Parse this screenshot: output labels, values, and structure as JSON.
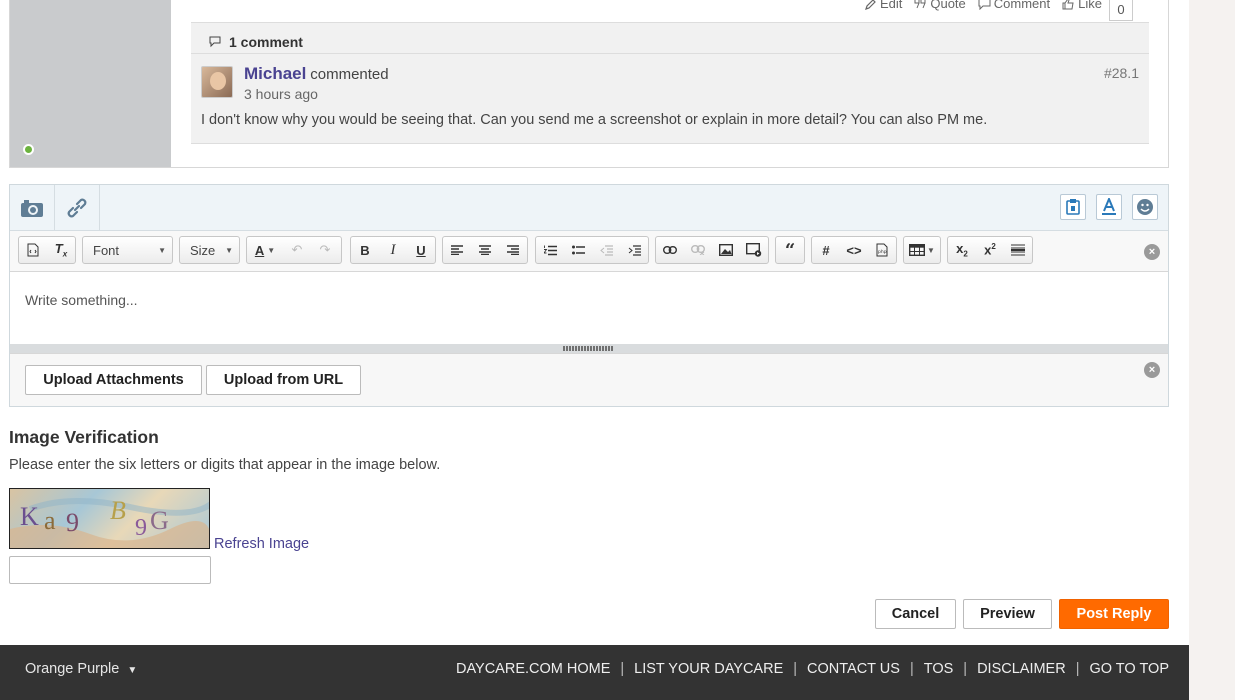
{
  "post": {
    "actions": {
      "edit": "Edit",
      "quote": "Quote",
      "comment": "Comment",
      "like": "Like"
    },
    "like_count": "0",
    "comments_header": "1 comment",
    "comment": {
      "author": "Michael",
      "verb": "commented",
      "time": "3 hours ago",
      "permalink": "#28.1",
      "text": "I don't know why you would be seeing that. Can you send me a screenshot or explain in more detail? You can also PM me."
    }
  },
  "editor": {
    "font_label": "Font",
    "size_label": "Size",
    "placeholder": "Write something...",
    "upload_attachments": "Upload Attachments",
    "upload_from_url": "Upload from URL"
  },
  "verification": {
    "title": "Image Verification",
    "description": "Please enter the six letters or digits that appear in the image below.",
    "refresh": "Refresh Image"
  },
  "actions": {
    "cancel": "Cancel",
    "preview": "Preview",
    "post_reply": "Post Reply"
  },
  "footer": {
    "theme": "Orange Purple",
    "links": [
      "DAYCARE.COM HOME",
      "LIST YOUR DAYCARE",
      "CONTACT US",
      "TOS",
      "DISCLAIMER",
      "GO TO TOP"
    ]
  },
  "colors": {
    "accent": "#ff6a00",
    "link": "#4a4391",
    "footer_bg": "#333333"
  }
}
